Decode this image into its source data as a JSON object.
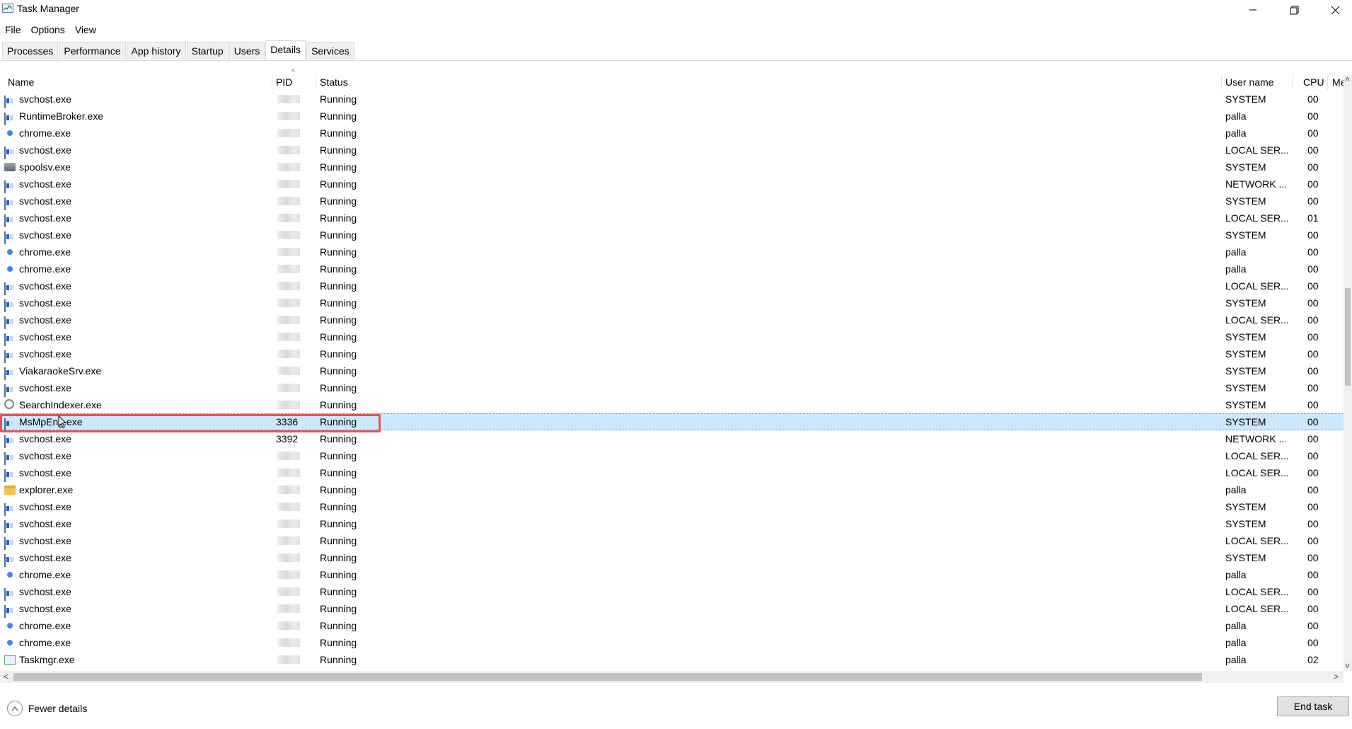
{
  "window": {
    "title": "Task Manager"
  },
  "menu": [
    "File",
    "Options",
    "View"
  ],
  "tabs": [
    {
      "label": "Processes",
      "active": false
    },
    {
      "label": "Performance",
      "active": false
    },
    {
      "label": "App history",
      "active": false
    },
    {
      "label": "Startup",
      "active": false
    },
    {
      "label": "Users",
      "active": false
    },
    {
      "label": "Details",
      "active": true
    },
    {
      "label": "Services",
      "active": false
    }
  ],
  "columns": {
    "name": "Name",
    "pid": "PID",
    "status": "Status",
    "user": "User name",
    "cpu": "CPU",
    "memory": "Me"
  },
  "rows": [
    {
      "icon": "service-icon",
      "name": "svchost.exe",
      "pid": "",
      "status": "Running",
      "user": "SYSTEM",
      "cpu": "00"
    },
    {
      "icon": "service-icon",
      "name": "RuntimeBroker.exe",
      "pid": "",
      "status": "Running",
      "user": "palla",
      "cpu": "00"
    },
    {
      "icon": "chrome-icon",
      "name": "chrome.exe",
      "pid": "",
      "status": "Running",
      "user": "palla",
      "cpu": "00"
    },
    {
      "icon": "service-icon",
      "name": "svchost.exe",
      "pid": "",
      "status": "Running",
      "user": "LOCAL SER...",
      "cpu": "00"
    },
    {
      "icon": "printer-icon",
      "name": "spoolsv.exe",
      "pid": "",
      "status": "Running",
      "user": "SYSTEM",
      "cpu": "00"
    },
    {
      "icon": "service-icon",
      "name": "svchost.exe",
      "pid": "",
      "status": "Running",
      "user": "NETWORK ...",
      "cpu": "00"
    },
    {
      "icon": "service-icon",
      "name": "svchost.exe",
      "pid": "",
      "status": "Running",
      "user": "SYSTEM",
      "cpu": "00"
    },
    {
      "icon": "service-icon",
      "name": "svchost.exe",
      "pid": "",
      "status": "Running",
      "user": "LOCAL SER...",
      "cpu": "01"
    },
    {
      "icon": "service-icon",
      "name": "svchost.exe",
      "pid": "",
      "status": "Running",
      "user": "SYSTEM",
      "cpu": "00"
    },
    {
      "icon": "chrome-icon",
      "name": "chrome.exe",
      "pid": "",
      "status": "Running",
      "user": "palla",
      "cpu": "00"
    },
    {
      "icon": "chrome-icon",
      "name": "chrome.exe",
      "pid": "",
      "status": "Running",
      "user": "palla",
      "cpu": "00"
    },
    {
      "icon": "service-icon",
      "name": "svchost.exe",
      "pid": "",
      "status": "Running",
      "user": "LOCAL SER...",
      "cpu": "00"
    },
    {
      "icon": "service-icon",
      "name": "svchost.exe",
      "pid": "",
      "status": "Running",
      "user": "SYSTEM",
      "cpu": "00"
    },
    {
      "icon": "service-icon",
      "name": "svchost.exe",
      "pid": "",
      "status": "Running",
      "user": "LOCAL SER...",
      "cpu": "00"
    },
    {
      "icon": "service-icon",
      "name": "svchost.exe",
      "pid": "",
      "status": "Running",
      "user": "SYSTEM",
      "cpu": "00"
    },
    {
      "icon": "service-icon",
      "name": "svchost.exe",
      "pid": "",
      "status": "Running",
      "user": "SYSTEM",
      "cpu": "00"
    },
    {
      "icon": "service-icon",
      "name": "ViakaraokeSrv.exe",
      "pid": "",
      "status": "Running",
      "user": "SYSTEM",
      "cpu": "00"
    },
    {
      "icon": "service-icon",
      "name": "svchost.exe",
      "pid": "",
      "status": "Running",
      "user": "SYSTEM",
      "cpu": "00"
    },
    {
      "icon": "search-indexer-icon",
      "name": "SearchIndexer.exe",
      "pid": "",
      "status": "Running",
      "user": "SYSTEM",
      "cpu": "00"
    },
    {
      "icon": "service-icon",
      "name": "MsMpEng.exe",
      "pid": "3336",
      "status": "Running",
      "user": "SYSTEM",
      "cpu": "00",
      "selected": true
    },
    {
      "icon": "service-icon",
      "name": "svchost.exe",
      "pid": "3392",
      "status": "Running",
      "user": "NETWORK ...",
      "cpu": "00"
    },
    {
      "icon": "service-icon",
      "name": "svchost.exe",
      "pid": "",
      "status": "Running",
      "user": "LOCAL SER...",
      "cpu": "00"
    },
    {
      "icon": "service-icon",
      "name": "svchost.exe",
      "pid": "",
      "status": "Running",
      "user": "LOCAL SER...",
      "cpu": "00"
    },
    {
      "icon": "folder-icon",
      "name": "explorer.exe",
      "pid": "",
      "status": "Running",
      "user": "palla",
      "cpu": "00"
    },
    {
      "icon": "service-icon",
      "name": "svchost.exe",
      "pid": "",
      "status": "Running",
      "user": "SYSTEM",
      "cpu": "00"
    },
    {
      "icon": "service-icon",
      "name": "svchost.exe",
      "pid": "",
      "status": "Running",
      "user": "SYSTEM",
      "cpu": "00"
    },
    {
      "icon": "service-icon",
      "name": "svchost.exe",
      "pid": "",
      "status": "Running",
      "user": "LOCAL SER...",
      "cpu": "00"
    },
    {
      "icon": "service-icon",
      "name": "svchost.exe",
      "pid": "",
      "status": "Running",
      "user": "SYSTEM",
      "cpu": "00"
    },
    {
      "icon": "chrome-icon",
      "name": "chrome.exe",
      "pid": "",
      "status": "Running",
      "user": "palla",
      "cpu": "00"
    },
    {
      "icon": "service-icon",
      "name": "svchost.exe",
      "pid": "",
      "status": "Running",
      "user": "LOCAL SER...",
      "cpu": "00"
    },
    {
      "icon": "service-icon",
      "name": "svchost.exe",
      "pid": "",
      "status": "Running",
      "user": "LOCAL SER...",
      "cpu": "00"
    },
    {
      "icon": "chrome-icon",
      "name": "chrome.exe",
      "pid": "",
      "status": "Running",
      "user": "palla",
      "cpu": "00"
    },
    {
      "icon": "chrome-icon",
      "name": "chrome.exe",
      "pid": "",
      "status": "Running",
      "user": "palla",
      "cpu": "00"
    },
    {
      "icon": "taskmgr-icon",
      "name": "Taskmgr.exe",
      "pid": "",
      "status": "Running",
      "user": "palla",
      "cpu": "02"
    }
  ],
  "footer": {
    "fewer_details": "Fewer details",
    "end_task": "End task"
  },
  "colors": {
    "selection": "#cce8ff",
    "highlight_outline": "#e05555"
  }
}
